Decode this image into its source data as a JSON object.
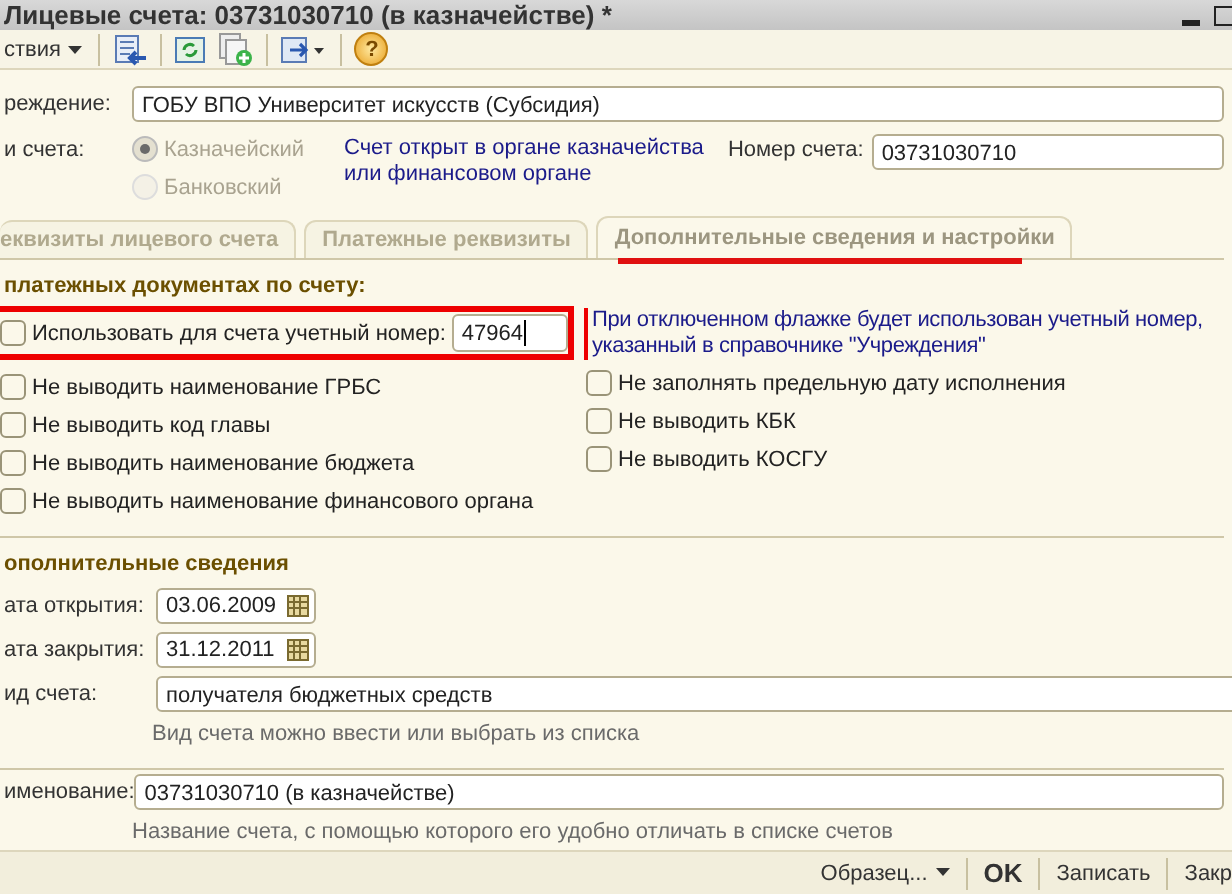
{
  "window": {
    "title": "Лицевые счета: 03731030710 (в казначействе) *"
  },
  "toolbar": {
    "actions_menu": "ствия",
    "help_glyph": "?"
  },
  "institution": {
    "label": "реждение:",
    "value": "ГОБУ ВПО Университет искусств (Субсидия)"
  },
  "account_type": {
    "label": "и счета:",
    "disabled": true,
    "options": [
      {
        "label": "Казначейский",
        "selected": true
      },
      {
        "label": "Банковский",
        "selected": false
      }
    ],
    "note": [
      "Счет открыт в органе казначейства",
      "или финансовом органе"
    ]
  },
  "account_number": {
    "label": "Номер счета:",
    "value": "03731030710"
  },
  "tabs": [
    {
      "label": "еквизиты лицевого счета",
      "selected": false
    },
    {
      "label": "Платежные реквизиты",
      "selected": false
    },
    {
      "label": "Дополнительные сведения и настройки",
      "selected": true
    }
  ],
  "print_section": {
    "title": "платежных документах по счету:",
    "use_number": {
      "label": "Использовать для счета учетный номер:",
      "checked": false,
      "value": "47964"
    },
    "note": [
      "При отключенном флажке будет использован учетный номер,",
      "указанный в справочнике \"Учреждения\""
    ],
    "left_options": [
      {
        "label": "Не выводить наименование ГРБС",
        "checked": false
      },
      {
        "label": "Не выводить код главы",
        "checked": false
      },
      {
        "label": "Не выводить наименование бюджета",
        "checked": false
      },
      {
        "label": "Не выводить наименование финансового органа",
        "checked": false
      }
    ],
    "right_options": [
      {
        "label": "Не заполнять предельную дату исполнения",
        "checked": false
      },
      {
        "label": "Не выводить КБК",
        "checked": false
      },
      {
        "label": "Не выводить КОСГУ",
        "checked": false
      }
    ]
  },
  "extra": {
    "title": "ополнительные сведения",
    "open_date": {
      "label": "ата открытия:",
      "value": "03.06.2009"
    },
    "close_date": {
      "label": "ата закрытия:",
      "value": "31.12.2011"
    },
    "account_kind": {
      "label": "ид счета:",
      "value": "получателя бюджетных средств",
      "hint": "Вид счета можно ввести или выбрать из списка"
    },
    "name": {
      "label": "именование:",
      "value": "03731030710 (в казначействе)",
      "hint": "Название счета, с помощью которого его удобно отличать в списке счетов"
    }
  },
  "footer": {
    "buttons": [
      {
        "label": "Образец...",
        "kind": "menu"
      },
      {
        "label": "OK",
        "kind": "default"
      },
      {
        "label": "Записать",
        "kind": "plain"
      },
      {
        "label": "Закр",
        "kind": "plain"
      }
    ]
  }
}
